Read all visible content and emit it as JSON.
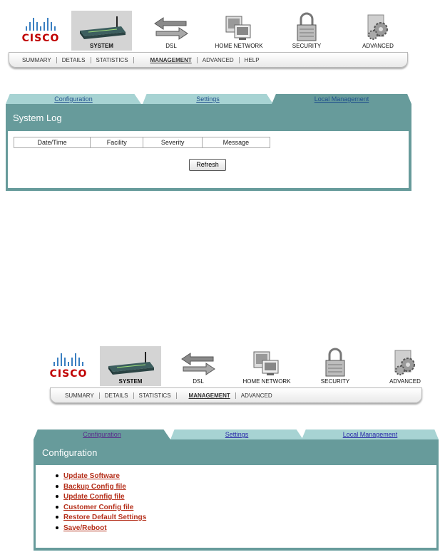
{
  "brand": "CISCO",
  "nav": {
    "items": [
      "SYSTEM",
      "DSL",
      "HOME NETWORK",
      "SECURITY",
      "ADVANCED"
    ],
    "active": "SYSTEM"
  },
  "subnav1": {
    "items": [
      "SUMMARY",
      "DETAILS",
      "STATISTICS",
      "MANAGEMENT",
      "ADVANCED",
      "HELP"
    ],
    "active": "MANAGEMENT"
  },
  "subnav2": {
    "items": [
      "SUMMARY",
      "DETAILS",
      "STATISTICS",
      "MANAGEMENT",
      "ADVANCED"
    ],
    "active": "MANAGEMENT"
  },
  "tabs": [
    "Configuration",
    "Settings",
    "Local Management"
  ],
  "syslog": {
    "title": "System Log",
    "columns": [
      "Date/Time",
      "Facility",
      "Severity",
      "Message"
    ],
    "refresh_label": "Refresh"
  },
  "config": {
    "title": "Configuration",
    "links": [
      "Update Software",
      "Backup Config file",
      "Update Config file",
      "Customer Config file",
      "Restore Default Settings",
      "Save/Reboot"
    ]
  },
  "colors": {
    "panel": "#679b9b",
    "tab_inactive": "#a7d3d3",
    "link": "#b52f1a",
    "logo_red": "#c00000"
  }
}
